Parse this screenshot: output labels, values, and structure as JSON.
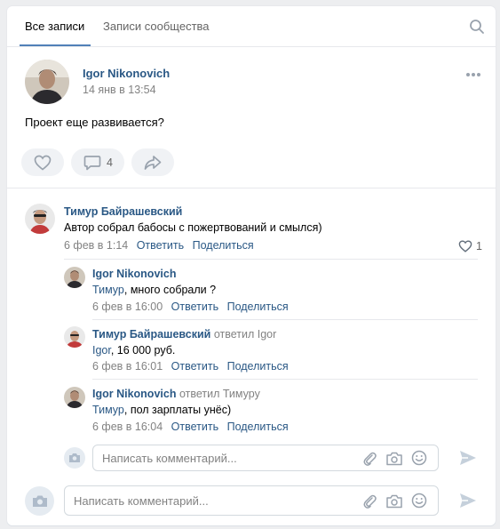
{
  "tabs": {
    "all_posts": "Все записи",
    "community_posts": "Записи сообщества"
  },
  "post": {
    "author": "Igor Nikonovich",
    "date": "14 янв в 13:54",
    "text": "Проект еще развивается?",
    "comments_count": "4"
  },
  "comments": [
    {
      "author": "Тимур Байрашевский",
      "replied_to": "",
      "mention": "",
      "text": "Автор собрал бабосы с пожертвований и смылся)",
      "date": "6 фев в 1:14",
      "reply": "Ответить",
      "share": "Поделиться",
      "likes": "1"
    },
    {
      "author": "Igor Nikonovich",
      "replied_to": "",
      "mention": "Тимур",
      "text": ", много собрали ?",
      "date": "6 фев в 16:00",
      "reply": "Ответить",
      "share": "Поделиться"
    },
    {
      "author": "Тимур Байрашевский",
      "replied_to": "ответил Igor",
      "mention": "Igor",
      "text": ", 16 000 руб.",
      "date": "6 фев в 16:01",
      "reply": "Ответить",
      "share": "Поделиться"
    },
    {
      "author": "Igor Nikonovich",
      "replied_to": "ответил Тимуру",
      "mention": "Тимур",
      "text": ", пол зарплаты унёс)",
      "date": "6 фев в 16:04",
      "reply": "Ответить",
      "share": "Поделиться"
    }
  ],
  "reply_input": {
    "placeholder": "Написать комментарий..."
  },
  "main_input": {
    "placeholder": "Написать комментарий..."
  },
  "colors": {
    "link": "#2a5885",
    "accent": "#5181b8",
    "icon": "#99a2ad"
  }
}
